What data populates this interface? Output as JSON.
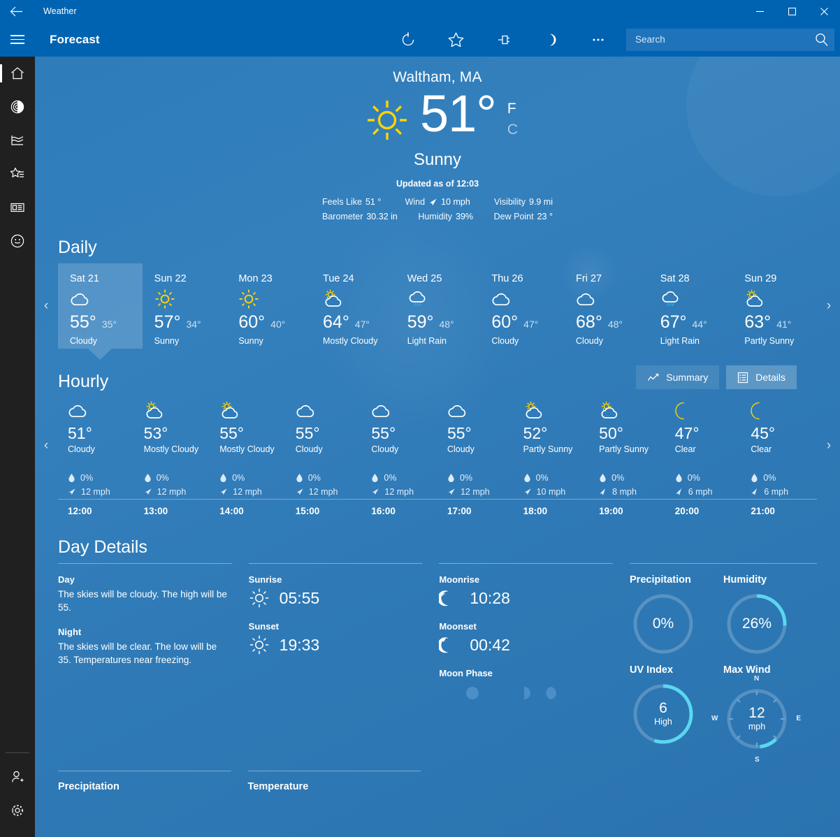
{
  "titlebar": {
    "back_label": "back-arrow",
    "app_title": "Weather",
    "minimize": "—",
    "maximize": "☐",
    "close": "✕"
  },
  "commandbar": {
    "page_title": "Forecast",
    "buttons": [
      {
        "name": "refresh",
        "icon": "refresh-icon"
      },
      {
        "name": "favorite",
        "icon": "star-icon"
      },
      {
        "name": "pin",
        "icon": "pin-icon"
      },
      {
        "name": "night-mode",
        "icon": "moon-icon"
      },
      {
        "name": "more",
        "icon": "ellipsis-icon"
      }
    ],
    "search": {
      "placeholder": "Search",
      "value": ""
    }
  },
  "rail": {
    "items": [
      {
        "name": "forecast",
        "icon": "home-icon",
        "active": true
      },
      {
        "name": "maps",
        "icon": "radar-icon",
        "active": false
      },
      {
        "name": "historical-weather",
        "icon": "chart-icon",
        "active": false
      },
      {
        "name": "favorites",
        "icon": "star-list-icon",
        "active": false
      },
      {
        "name": "news",
        "icon": "news-icon",
        "active": false
      },
      {
        "name": "send-feedback",
        "icon": "smiley-icon",
        "active": false
      }
    ],
    "bottom": [
      {
        "name": "account",
        "icon": "person-add-icon"
      },
      {
        "name": "settings",
        "icon": "gear-icon"
      }
    ]
  },
  "current": {
    "city": "Waltham, MA",
    "icon": "sunny-icon",
    "temperature": "51",
    "degree": "°",
    "unit_f": "F",
    "unit_c": "C",
    "unit_selected": "F",
    "condition": "Sunny",
    "updated": "Updated as of 12:03",
    "metrics": [
      {
        "label": "Feels Like",
        "value": "51 °",
        "icon": null
      },
      {
        "label": "Wind",
        "value": "10 mph",
        "icon": "wind-arrow-icon"
      },
      {
        "label": "Visibility",
        "value": "9.9 mi",
        "icon": null
      },
      {
        "label": "Barometer",
        "value": "30.32 in",
        "icon": null
      },
      {
        "label": "Humidity",
        "value": "39%",
        "icon": null
      },
      {
        "label": "Dew Point",
        "value": "23 °",
        "icon": null
      }
    ]
  },
  "daily": {
    "heading": "Daily",
    "prev_arrow": "‹",
    "next_arrow": "›",
    "days": [
      {
        "name": "Sat 21",
        "icon": "cloudy-icon",
        "high": "55°",
        "low": "35°",
        "desc": "Cloudy",
        "selected": true
      },
      {
        "name": "Sun 22",
        "icon": "sunny-icon",
        "high": "57°",
        "low": "34°",
        "desc": "Sunny",
        "selected": false
      },
      {
        "name": "Mon 23",
        "icon": "sunny-icon",
        "high": "60°",
        "low": "40°",
        "desc": "Sunny",
        "selected": false
      },
      {
        "name": "Tue 24",
        "icon": "partly-sunny-icon",
        "high": "64°",
        "low": "47°",
        "desc": "Mostly Cloudy",
        "selected": false
      },
      {
        "name": "Wed 25",
        "icon": "rain-icon",
        "high": "59°",
        "low": "48°",
        "desc": "Light Rain",
        "selected": false
      },
      {
        "name": "Thu 26",
        "icon": "cloudy-icon",
        "high": "60°",
        "low": "47°",
        "desc": "Cloudy",
        "selected": false
      },
      {
        "name": "Fri 27",
        "icon": "cloudy-icon",
        "high": "68°",
        "low": "48°",
        "desc": "Cloudy",
        "selected": false
      },
      {
        "name": "Sat 28",
        "icon": "rain-icon",
        "high": "67°",
        "low": "44°",
        "desc": "Light Rain",
        "selected": false
      },
      {
        "name": "Sun 29",
        "icon": "partly-sunny-icon",
        "high": "63°",
        "low": "41°",
        "desc": "Partly Sunny",
        "selected": false
      }
    ]
  },
  "hourly": {
    "heading": "Hourly",
    "prev_arrow": "‹",
    "next_arrow": "›",
    "summary_label": "Summary",
    "details_label": "Details",
    "active_view": "Details",
    "hours": [
      {
        "time": "12:00",
        "icon": "cloudy-icon",
        "temp": "51°",
        "desc": "Cloudy",
        "precip": "0%",
        "wind": "12 mph"
      },
      {
        "time": "13:00",
        "icon": "partly-sunny-icon",
        "temp": "53°",
        "desc": "Mostly Cloudy",
        "precip": "0%",
        "wind": "12 mph"
      },
      {
        "time": "14:00",
        "icon": "partly-sunny-icon",
        "temp": "55°",
        "desc": "Mostly Cloudy",
        "precip": "0%",
        "wind": "12 mph"
      },
      {
        "time": "15:00",
        "icon": "cloudy-icon",
        "temp": "55°",
        "desc": "Cloudy",
        "precip": "0%",
        "wind": "12 mph"
      },
      {
        "time": "16:00",
        "icon": "cloudy-icon",
        "temp": "55°",
        "desc": "Cloudy",
        "precip": "0%",
        "wind": "12 mph"
      },
      {
        "time": "17:00",
        "icon": "cloudy-icon",
        "temp": "55°",
        "desc": "Cloudy",
        "precip": "0%",
        "wind": "12 mph"
      },
      {
        "time": "18:00",
        "icon": "partly-sunny-icon",
        "temp": "52°",
        "desc": "Partly Sunny",
        "precip": "0%",
        "wind": "10 mph"
      },
      {
        "time": "19:00",
        "icon": "partly-sunny-icon",
        "temp": "50°",
        "desc": "Partly Sunny",
        "precip": "0%",
        "wind": "8 mph"
      },
      {
        "time": "20:00",
        "icon": "moon-icon",
        "temp": "47°",
        "desc": "Clear",
        "precip": "0%",
        "wind": "6 mph"
      },
      {
        "time": "21:00",
        "icon": "moon-icon",
        "temp": "45°",
        "desc": "Clear",
        "precip": "0%",
        "wind": "6 mph"
      }
    ]
  },
  "day_details": {
    "heading": "Day Details",
    "day_label": "Day",
    "day_text": "The skies will be cloudy. The high will be 55.",
    "night_label": "Night",
    "night_text": "The skies will be clear. The low will be 35. Temperatures near freezing.",
    "sunrise_label": "Sunrise",
    "sunrise_value": "05:55",
    "sunset_label": "Sunset",
    "sunset_value": "19:33",
    "moonrise_label": "Moonrise",
    "moonrise_value": "10:28",
    "moonset_label": "Moonset",
    "moonset_value": "00:42",
    "moonphase_label": "Moon Phase",
    "moonphase_selected_index": 2,
    "gauges": [
      {
        "label": "Precipitation",
        "value": "0%",
        "sub": "",
        "percent": 0,
        "name": "precipitation-gauge"
      },
      {
        "label": "Humidity",
        "value": "26%",
        "sub": "",
        "percent": 26,
        "name": "humidity-gauge"
      },
      {
        "label": "UV Index",
        "value": "6",
        "sub": "High",
        "percent": 55,
        "name": "uv-index-gauge"
      },
      {
        "label": "Max Wind",
        "value": "12",
        "sub": "mph",
        "percent": 0,
        "name": "max-wind-gauge",
        "compass": {
          "n": "N",
          "e": "E",
          "s": "S",
          "w": "W"
        }
      }
    ]
  },
  "bottom_charts": [
    {
      "label": "Precipitation"
    },
    {
      "label": "Temperature"
    }
  ],
  "colors": {
    "title_bar": "#0063b1",
    "rail": "#202020",
    "content_top": "#2e7cba",
    "content_bottom": "#2a73b0",
    "accent_cyan": "#5ad7ef",
    "sun_yellow": "#ffd400",
    "rain_blue": "#2aa8e0"
  }
}
